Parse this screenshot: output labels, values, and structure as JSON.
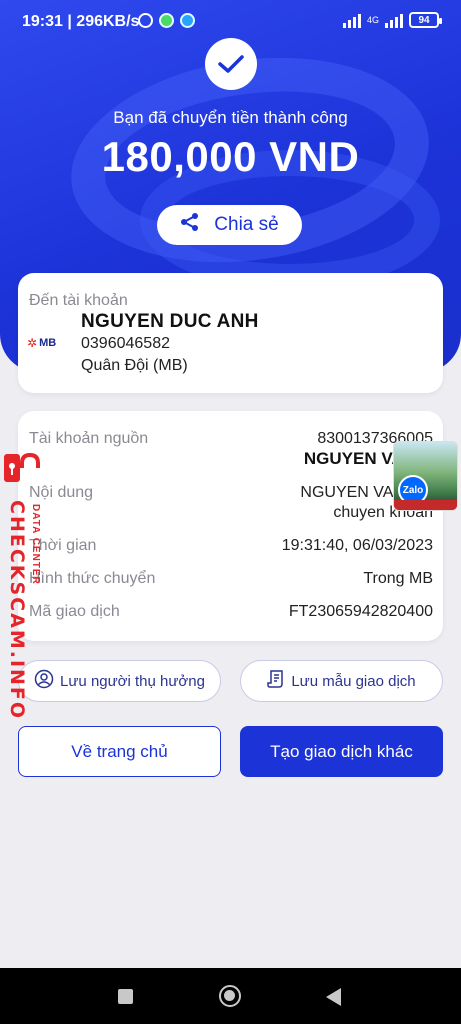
{
  "status_bar": {
    "time": "19:31",
    "speed": "296KB/s",
    "network": "4G",
    "battery": "94"
  },
  "success": {
    "message": "Bạn đã chuyển tiền thành công",
    "amount": "180,000 VND",
    "share_label": "Chia sẻ"
  },
  "destination": {
    "label": "Đến tài khoản",
    "bank_logo": "MB",
    "name": "NGUYEN DUC ANH",
    "account": "0396046582",
    "bank": "Quân Đội (MB)"
  },
  "details": {
    "source_label": "Tài khoản nguồn",
    "source_account": "8300137366005",
    "source_name": "NGUYEN VAN D",
    "content_label": "Nội dung",
    "content_line1": "NGUYEN VAN",
    "content_line2": "chuyen khoan",
    "time_label": "Thời gian",
    "time_value": "19:31:40, 06/03/2023",
    "method_label": "Hình thức chuyển",
    "method_value": "Trong MB",
    "txn_label": "Mã giao dịch",
    "txn_value": "FT23065942820400"
  },
  "actions": {
    "save_beneficiary": "Lưu người thụ hưởng",
    "save_template": "Lưu mẫu giao dịch",
    "home": "Về trang chủ",
    "new_transaction": "Tạo giao dịch khác"
  },
  "watermark": {
    "main": "CHECKSCAM.INFO",
    "sub": "DATA CENTER"
  },
  "overlay": {
    "zalo": "Zalo"
  },
  "colors": {
    "primary": "#1c33d8",
    "watermark": "#e5252a"
  }
}
